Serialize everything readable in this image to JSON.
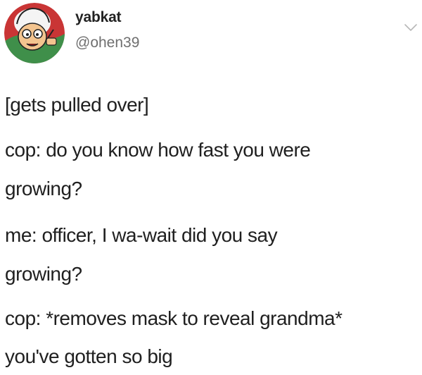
{
  "header": {
    "display_name": "yabkat",
    "handle": "@ohen39",
    "avatar_icon": "cartoon-avatar-icon",
    "menu_icon": "chevron-down-icon"
  },
  "tweet": {
    "lines": [
      "[gets pulled over]",
      "cop: do you know how fast you were",
      "growing?",
      "me: officer, I wa-wait did you say",
      "growing?",
      "cop: *removes mask to reveal grandma*",
      "you've gotten so big"
    ]
  },
  "colors": {
    "text": "#202020",
    "handle": "#6f6f6f",
    "background": "#ffffff"
  }
}
